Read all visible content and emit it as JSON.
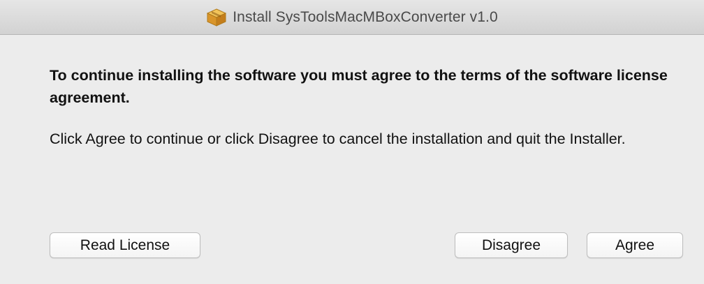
{
  "window": {
    "title": "Install SysToolsMacMBoxConverter v1.0",
    "title_icon": "installer-package-icon"
  },
  "dialog": {
    "heading": "To continue installing the software you must agree to the terms of the software license agreement.",
    "message": "Click Agree to continue or click Disagree to cancel the installation and quit the Installer."
  },
  "buttons": {
    "read_license": "Read License",
    "disagree": "Disagree",
    "agree": "Agree"
  },
  "colors": {
    "background": "#ececec",
    "titlebar": "#d9d9d9",
    "button": "#ffffff"
  }
}
